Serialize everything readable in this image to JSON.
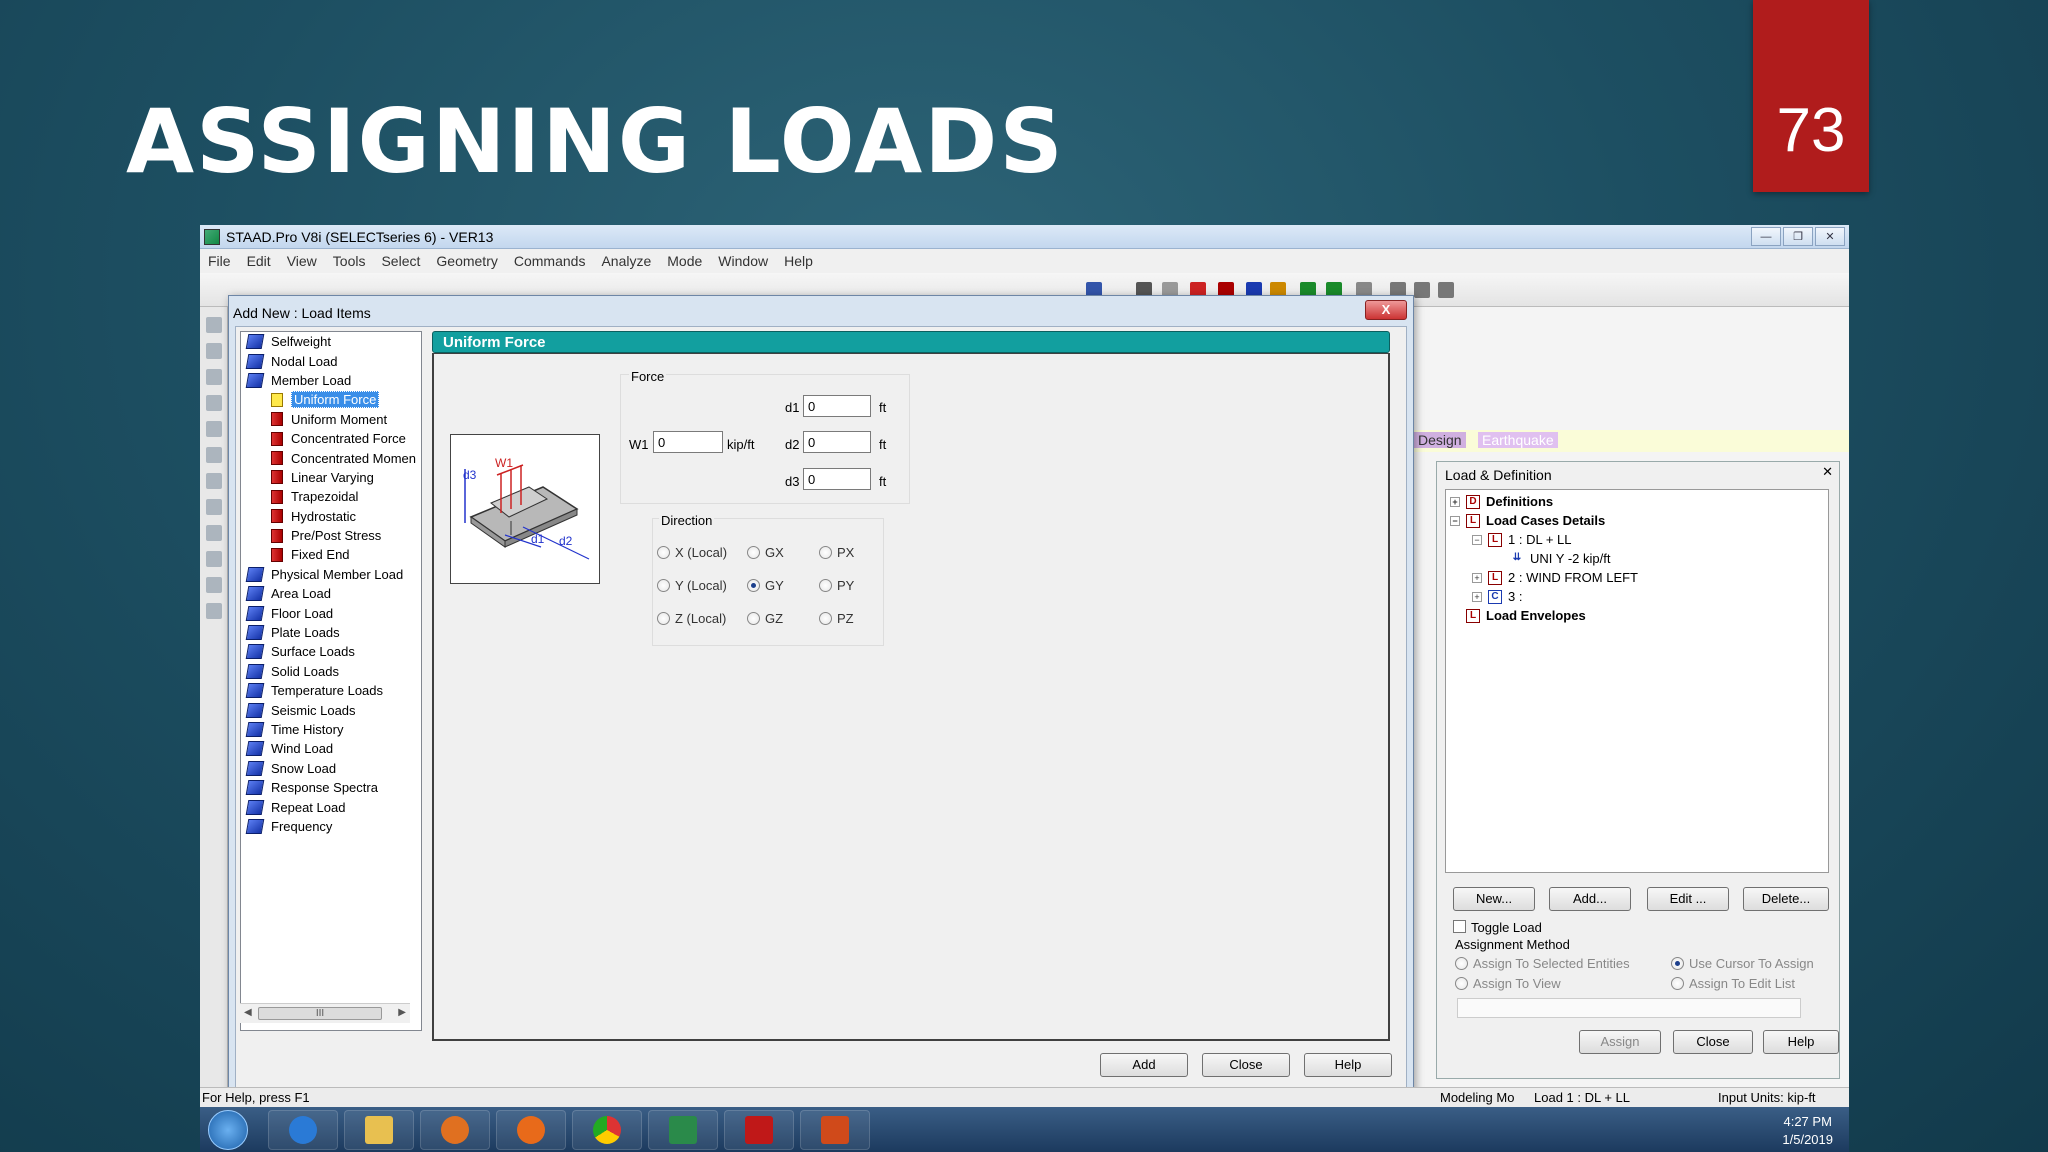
{
  "slide": {
    "title": "ASSIGNING LOADS",
    "number": "73"
  },
  "app": {
    "title": "STAAD.Pro V8i (SELECTseries 6) - VER13",
    "menu": [
      "File",
      "Edit",
      "View",
      "Tools",
      "Select",
      "Geometry",
      "Commands",
      "Analyze",
      "Mode",
      "Window",
      "Help"
    ]
  },
  "dialog": {
    "title": "Add New : Load Items",
    "close_glyph": "X",
    "tree": [
      {
        "label": "Selfweight",
        "level": 0
      },
      {
        "label": "Nodal Load",
        "level": 0
      },
      {
        "label": "Member Load",
        "level": 0
      },
      {
        "label": "Uniform Force",
        "level": 1,
        "selected": true
      },
      {
        "label": "Uniform Moment",
        "level": 1
      },
      {
        "label": "Concentrated Force",
        "level": 1
      },
      {
        "label": "Concentrated Momen",
        "level": 1
      },
      {
        "label": "Linear Varying",
        "level": 1
      },
      {
        "label": "Trapezoidal",
        "level": 1
      },
      {
        "label": "Hydrostatic",
        "level": 1
      },
      {
        "label": "Pre/Post Stress",
        "level": 1
      },
      {
        "label": "Fixed End",
        "level": 1
      },
      {
        "label": "Physical Member Load",
        "level": 0
      },
      {
        "label": "Area Load",
        "level": 0
      },
      {
        "label": "Floor Load",
        "level": 0
      },
      {
        "label": "Plate Loads",
        "level": 0
      },
      {
        "label": "Surface Loads",
        "level": 0
      },
      {
        "label": "Solid Loads",
        "level": 0
      },
      {
        "label": "Temperature Loads",
        "level": 0
      },
      {
        "label": "Seismic Loads",
        "level": 0
      },
      {
        "label": "Time History",
        "level": 0
      },
      {
        "label": "Wind Load",
        "level": 0
      },
      {
        "label": "Snow Load",
        "level": 0
      },
      {
        "label": "Response Spectra",
        "level": 0
      },
      {
        "label": "Repeat Load",
        "level": 0
      },
      {
        "label": "Frequency",
        "level": 0
      }
    ],
    "scroll_thumb": "III",
    "panel_title": "Uniform Force",
    "diagram_labels": {
      "d3": "d3",
      "w1": "W1",
      "d1": "d1",
      "d2": "d2"
    },
    "force": {
      "group_label": "Force",
      "w1_label": "W1",
      "w1_value": "0",
      "w1_unit": "kip/ft",
      "d1_label": "d1",
      "d1_value": "0",
      "d1_unit": "ft",
      "d2_label": "d2",
      "d2_value": "0",
      "d2_unit": "ft",
      "d3_label": "d3",
      "d3_value": "0",
      "d3_unit": "ft"
    },
    "direction": {
      "group_label": "Direction",
      "options": [
        "X (Local)",
        "GX",
        "PX",
        "Y (Local)",
        "GY",
        "PY",
        "Z (Local)",
        "GZ",
        "PZ"
      ],
      "selected": "GY"
    },
    "buttons": {
      "add": "Add",
      "close": "Close",
      "help": "Help"
    }
  },
  "tabs": {
    "design": "Design",
    "earthquake": "Earthquake"
  },
  "load_panel": {
    "title": "Load & Definition",
    "close_glyph": "✕",
    "tree": {
      "definitions": "Definitions",
      "load_cases": "Load Cases Details",
      "case1": "1 : DL + LL",
      "case1_item": "UNI Y -2 kip/ft",
      "case2": "2 : WIND FROM LEFT",
      "case3": "3 :",
      "envelopes": "Load Envelopes"
    },
    "buttons": {
      "new": "New...",
      "add": "Add...",
      "edit": "Edit ...",
      "delete": "Delete..."
    },
    "toggle_load": "Toggle Load",
    "assignment_method": "Assignment Method",
    "assign_selected": "Assign To Selected Entities",
    "assign_view": "Assign To View",
    "use_cursor": "Use Cursor To Assign",
    "assign_edit_list": "Assign To Edit List",
    "bottom_buttons": {
      "assign": "Assign",
      "close": "Close",
      "help": "Help"
    }
  },
  "status": {
    "left": "For Help, press F1",
    "mode": "Modeling Mo",
    "load": "Load 1 : DL + LL",
    "units": "Input Units:  kip-ft"
  },
  "taskbar": {
    "time": "4:27 PM",
    "date": "1/5/2019"
  },
  "colors": {
    "accent": "#129f9f",
    "slide_number_bg": "#b01c1c"
  }
}
